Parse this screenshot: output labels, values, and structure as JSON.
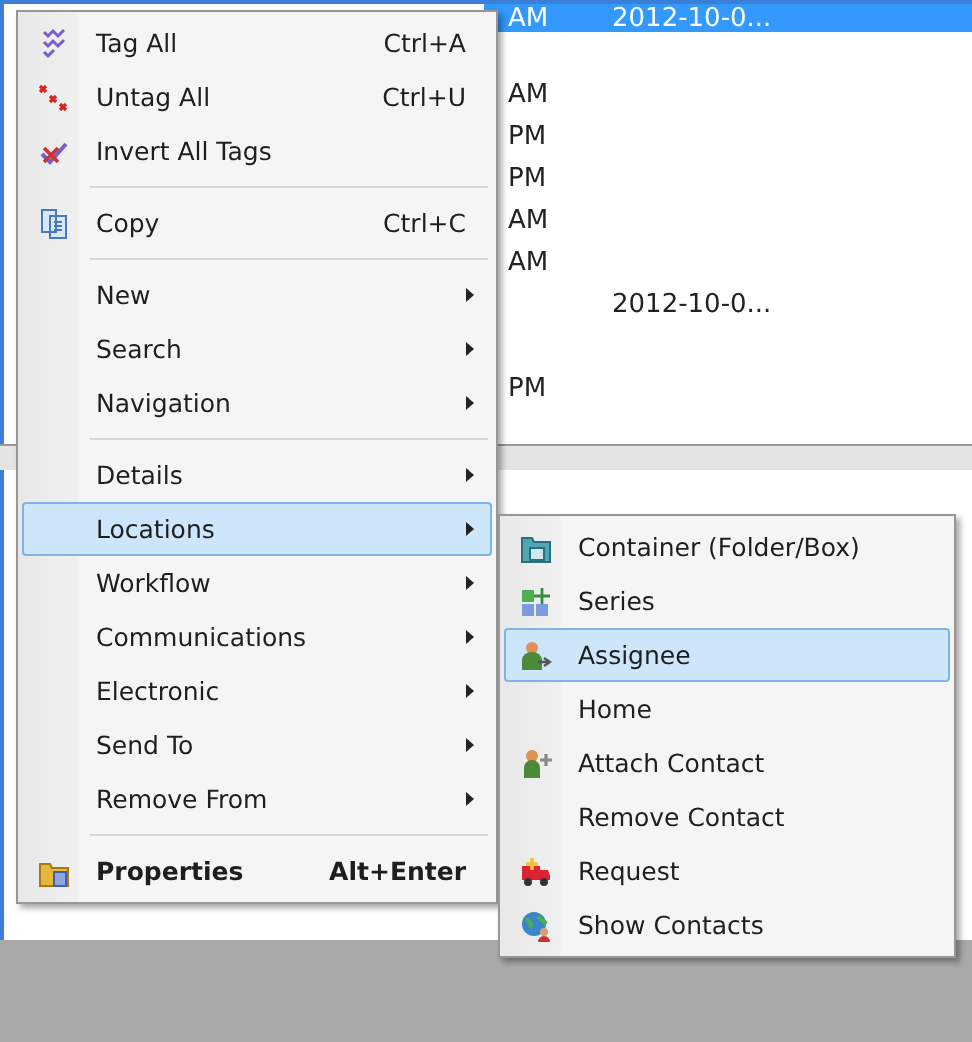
{
  "list_rows": [
    {
      "kind": "row",
      "time": "AM",
      "date": "2012-10-0...",
      "selected": true
    },
    {
      "kind": "blank"
    },
    {
      "kind": "row",
      "time": "AM",
      "selected": false
    },
    {
      "kind": "row",
      "time": "PM",
      "selected": false
    },
    {
      "kind": "row",
      "time": "PM",
      "selected": false
    },
    {
      "kind": "row",
      "time": "AM",
      "selected": false
    },
    {
      "kind": "row",
      "time": "AM",
      "selected": false
    },
    {
      "kind": "row",
      "date": "2012-10-0...",
      "selected": false
    },
    {
      "kind": "blank"
    },
    {
      "kind": "row",
      "time": "PM",
      "selected": false
    }
  ],
  "context_menu": {
    "items": [
      {
        "kind": "item",
        "label": "Tag All",
        "shortcut": "Ctrl+A",
        "selected": false
      },
      {
        "kind": "item",
        "label": "Untag All",
        "shortcut": "Ctrl+U",
        "selected": false
      },
      {
        "kind": "item",
        "label": "Invert All Tags",
        "selected": false
      },
      {
        "kind": "separator"
      },
      {
        "kind": "item",
        "label": "Copy",
        "shortcut": "Ctrl+C",
        "selected": false
      },
      {
        "kind": "separator"
      },
      {
        "kind": "submenu",
        "label": "New",
        "selected": false
      },
      {
        "kind": "submenu",
        "label": "Search",
        "selected": false
      },
      {
        "kind": "submenu",
        "label": "Navigation",
        "selected": false
      },
      {
        "kind": "separator"
      },
      {
        "kind": "submenu",
        "label": "Details",
        "selected": false
      },
      {
        "kind": "submenu",
        "label": "Locations",
        "selected": true
      },
      {
        "kind": "submenu",
        "label": "Workflow",
        "selected": false
      },
      {
        "kind": "submenu",
        "label": "Communications",
        "selected": false
      },
      {
        "kind": "submenu",
        "label": "Electronic",
        "selected": false
      },
      {
        "kind": "submenu",
        "label": "Send To",
        "selected": false
      },
      {
        "kind": "submenu",
        "label": "Remove From",
        "selected": false
      },
      {
        "kind": "separator"
      },
      {
        "kind": "default",
        "label": "Properties",
        "shortcut": "Alt+Enter",
        "selected": false
      }
    ]
  },
  "submenu": {
    "items": [
      {
        "label": "Container (Folder/Box)",
        "selected": false
      },
      {
        "label": "Series",
        "selected": false
      },
      {
        "label": "Assignee",
        "selected": true
      },
      {
        "label": "Home",
        "selected": false
      },
      {
        "label": "Attach Contact",
        "selected": false
      },
      {
        "label": "Remove Contact",
        "selected": false
      },
      {
        "label": "Request",
        "selected": false
      },
      {
        "label": "Show Contacts",
        "selected": false
      }
    ]
  }
}
